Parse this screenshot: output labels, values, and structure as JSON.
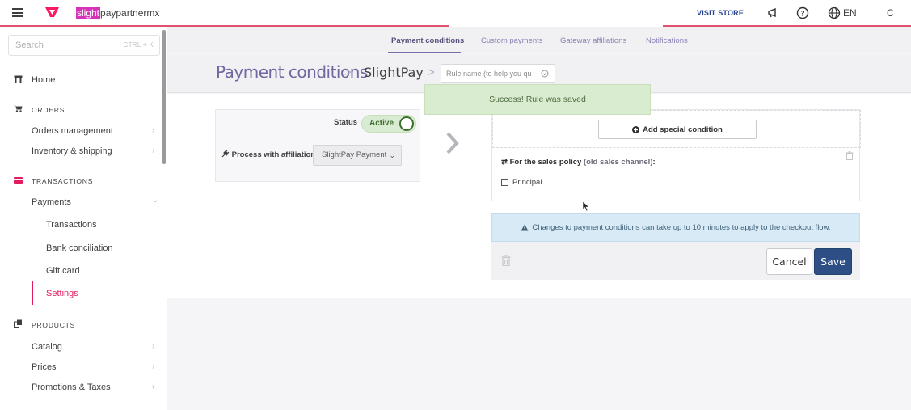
{
  "header": {
    "account_highlight": "slight",
    "account_rest": "paypartnermx",
    "visit_store": "VISIT STORE",
    "language": "EN",
    "user_initial": "C",
    "brand_color": "#f71963"
  },
  "sidebar": {
    "search_placeholder": "Search",
    "search_shortcut": "CTRL + K",
    "home": "Home",
    "orders_section": "ORDERS",
    "orders_management": "Orders management",
    "inventory_shipping": "Inventory & shipping",
    "transactions_section": "TRANSACTIONS",
    "payments": "Payments",
    "transactions": "Transactions",
    "bank_conciliation": "Bank conciliation",
    "gift_card": "Gift card",
    "settings": "Settings",
    "products_section": "PRODUCTS",
    "catalog": "Catalog",
    "prices": "Prices",
    "promotions_taxes": "Promotions & Taxes"
  },
  "tabs": {
    "payment_conditions": "Payment conditions",
    "custom_payments": "Custom payments",
    "gateway_affiliations": "Gateway affiliations",
    "notifications": "Notifications"
  },
  "breadcrumb": {
    "title": "Payment conditions",
    "separator": ">",
    "sub": "SlightPay",
    "rule_placeholder": "Rule name (to help you qu"
  },
  "toast": {
    "message": "Success! Rule was saved"
  },
  "status_card": {
    "status_label": "Status",
    "status_value": "Active",
    "affiliation_label": "Process with affiliation:",
    "affiliation_value": "SlightPay Payment"
  },
  "conditions": {
    "add_button": "Add special condition",
    "sales_policy_label": "For the sales policy",
    "sales_policy_muted": "(old sales channel)",
    "sales_policy_colon": ":",
    "principal": "Principal"
  },
  "info": {
    "message": "Changes to payment conditions can take up to 10 minutes to apply to the checkout flow."
  },
  "footer": {
    "cancel": "Cancel",
    "save": "Save"
  }
}
